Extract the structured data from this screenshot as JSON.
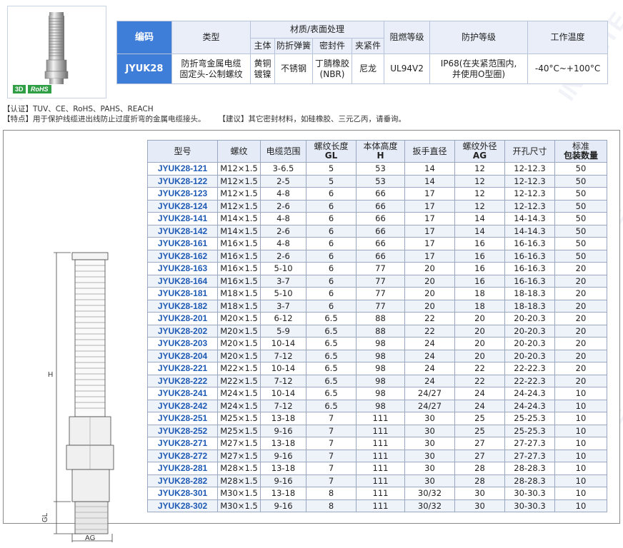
{
  "product_badges": {
    "three_d": "3D",
    "rohs": "RoHS"
  },
  "spec_table": {
    "headers": {
      "code": "编码",
      "type": "类型",
      "material_group": "材质/表面处理",
      "body": "主体",
      "spring": "防折弹簧",
      "seal": "密封件",
      "clamp": "夹紧件",
      "flame": "阻燃等级",
      "protection": "防护等级",
      "temp": "工作温度"
    },
    "row": {
      "code": "JYUK28",
      "type_line1": "防折弯金属电缆",
      "type_line2": "固定头-公制螺纹",
      "body_line1": "黄铜",
      "body_line2": "镀镍",
      "spring": "不锈钢",
      "seal_line1": "丁腈橡胶",
      "seal_line2": "(NBR)",
      "clamp": "尼龙",
      "flame": "UL94V2",
      "protection_line1": "IP68(在夹紧范围内,",
      "protection_line2": "并使用O型圈)",
      "temp": "-40°C~+100°C"
    }
  },
  "notes": {
    "certification": "【认证】TUV、CE、RoHS、PAHS、REACH",
    "feature": "【特点】用于保护线缆进出线防止过度折弯的金属电缆接头。",
    "suggestion": "【建议】其它密封材料，如硅橡胶、三元乙丙，请垂询。"
  },
  "drawing_labels": {
    "h": "H",
    "gl": "GL",
    "ag": "AG"
  },
  "watermark": "INFINITE",
  "model_table": {
    "headers": [
      "型号",
      "螺纹",
      "电缆范围",
      "螺纹长度\nGL",
      "本体高度\nH",
      "扳手直径",
      "螺纹外径\nAG",
      "开孔尺寸",
      "标准\n包装数量"
    ],
    "rows": [
      [
        "JYUK28-121",
        "M12×1.5",
        "3-6.5",
        "5",
        "53",
        "14",
        "12",
        "12-12.3",
        "50"
      ],
      [
        "JYUK28-122",
        "M12×1.5",
        "2-5",
        "5",
        "53",
        "14",
        "12",
        "12-12.3",
        "50"
      ],
      [
        "JYUK28-123",
        "M12×1.5",
        "4-8",
        "6",
        "66",
        "17",
        "12",
        "12-12.3",
        "50"
      ],
      [
        "JYUK28-124",
        "M12×1.5",
        "2-6",
        "6",
        "66",
        "17",
        "12",
        "12-12.3",
        "50"
      ],
      [
        "JYUK28-141",
        "M14×1.5",
        "4-8",
        "6",
        "66",
        "17",
        "14",
        "14-14.3",
        "50"
      ],
      [
        "JYUK28-142",
        "M14×1.5",
        "2-6",
        "6",
        "66",
        "17",
        "14",
        "14-14.3",
        "50"
      ],
      [
        "JYUK28-161",
        "M16×1.5",
        "4-8",
        "6",
        "66",
        "17",
        "16",
        "16-16.3",
        "50"
      ],
      [
        "JYUK28-162",
        "M16×1.5",
        "2-6",
        "6",
        "66",
        "17",
        "16",
        "16-16.3",
        "50"
      ],
      [
        "JYUK28-163",
        "M16×1.5",
        "5-10",
        "6",
        "77",
        "20",
        "16",
        "16-16.3",
        "20"
      ],
      [
        "JYUK28-164",
        "M16×1.5",
        "3-7",
        "6",
        "77",
        "20",
        "16",
        "16-16.3",
        "20"
      ],
      [
        "JYUK28-181",
        "M18×1.5",
        "5-10",
        "6",
        "77",
        "20",
        "18",
        "18-18.3",
        "20"
      ],
      [
        "JYUK28-182",
        "M18×1.5",
        "3-7",
        "6",
        "77",
        "20",
        "18",
        "18-18.3",
        "20"
      ],
      [
        "JYUK28-201",
        "M20×1.5",
        "6-12",
        "6.5",
        "88",
        "22",
        "20",
        "20-20.3",
        "20"
      ],
      [
        "JYUK28-202",
        "M20×1.5",
        "5-9",
        "6.5",
        "88",
        "22",
        "20",
        "20-20.3",
        "20"
      ],
      [
        "JYUK28-203",
        "M20×1.5",
        "10-14",
        "6.5",
        "98",
        "24",
        "20",
        "20-20.3",
        "20"
      ],
      [
        "JYUK28-204",
        "M20×1.5",
        "7-12",
        "6.5",
        "98",
        "24",
        "20",
        "20-20.3",
        "20"
      ],
      [
        "JYUK28-221",
        "M22×1.5",
        "10-14",
        "6.5",
        "98",
        "24",
        "22",
        "22-22.3",
        "20"
      ],
      [
        "JYUK28-222",
        "M22×1.5",
        "7-12",
        "6.5",
        "98",
        "24",
        "22",
        "22-22.3",
        "20"
      ],
      [
        "JYUK28-241",
        "M24×1.5",
        "10-14",
        "6.5",
        "98",
        "24/27",
        "24",
        "24-24.3",
        "10"
      ],
      [
        "JYUK28-242",
        "M24×1.5",
        "7-12",
        "6.5",
        "98",
        "24/27",
        "24",
        "24-24.3",
        "10"
      ],
      [
        "JYUK28-251",
        "M25×1.5",
        "13-18",
        "7",
        "111",
        "30",
        "25",
        "25-25.3",
        "10"
      ],
      [
        "JYUK28-252",
        "M25×1.5",
        "9-16",
        "7",
        "111",
        "30",
        "25",
        "25-25.3",
        "10"
      ],
      [
        "JYUK28-271",
        "M27×1.5",
        "13-18",
        "7",
        "111",
        "30",
        "27",
        "27-27.3",
        "10"
      ],
      [
        "JYUK28-272",
        "M27×1.5",
        "9-16",
        "7",
        "111",
        "30",
        "27",
        "27-27.3",
        "10"
      ],
      [
        "JYUK28-281",
        "M28×1.5",
        "13-18",
        "7",
        "111",
        "30",
        "28",
        "28-28.3",
        "10"
      ],
      [
        "JYUK28-282",
        "M28×1.5",
        "9-16",
        "7",
        "111",
        "30",
        "28",
        "28-28.3",
        "10"
      ],
      [
        "JYUK28-301",
        "M30×1.5",
        "13-18",
        "8",
        "111",
        "30/32",
        "30",
        "30-30.3",
        "10"
      ],
      [
        "JYUK28-302",
        "M30×1.5",
        "9-16",
        "8",
        "111",
        "30/32",
        "30",
        "30-30.3",
        "10"
      ]
    ]
  }
}
